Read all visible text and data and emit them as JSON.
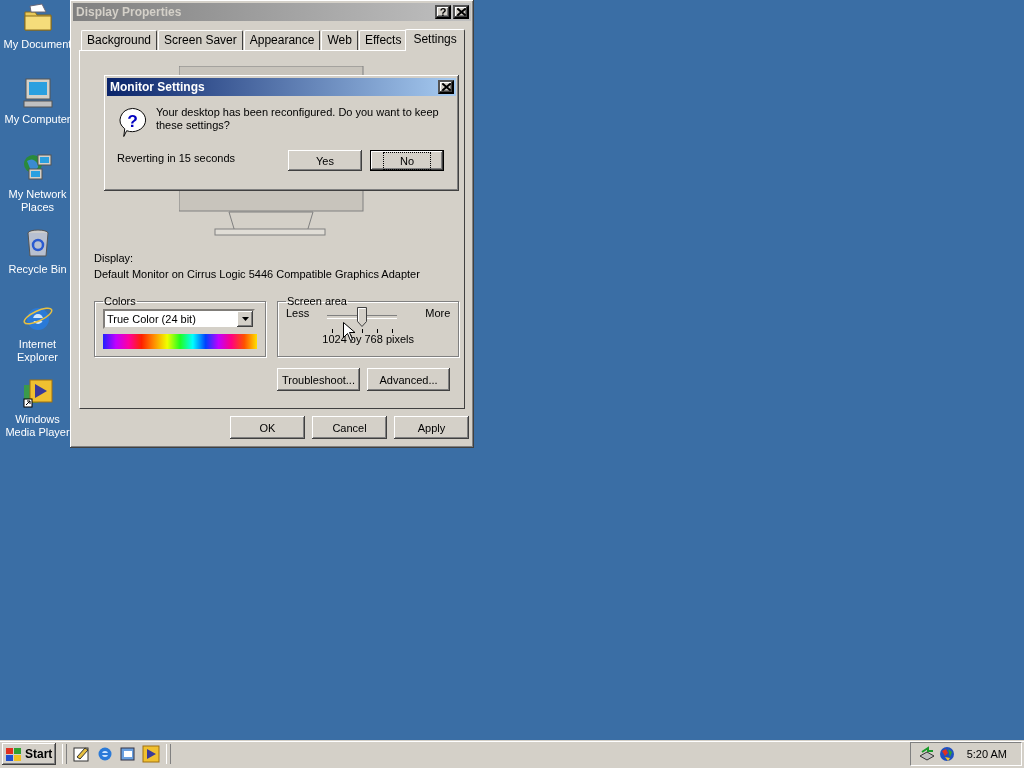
{
  "desktop_icons": [
    {
      "kind": "documents",
      "label": "My Document"
    },
    {
      "kind": "computer",
      "label": "My Computer"
    },
    {
      "kind": "network",
      "label": "My Network Places"
    },
    {
      "kind": "recycle",
      "label": "Recycle Bin"
    },
    {
      "kind": "browser",
      "label": "Internet Explorer"
    },
    {
      "kind": "media",
      "label": "Windows Media Player"
    }
  ],
  "display_properties": {
    "title": "Display Properties",
    "help_button": "?",
    "tabs": [
      {
        "label": "Background",
        "selected": false
      },
      {
        "label": "Screen Saver",
        "selected": false
      },
      {
        "label": "Appearance",
        "selected": false
      },
      {
        "label": "Web",
        "selected": false
      },
      {
        "label": "Effects",
        "selected": false
      },
      {
        "label": "Settings",
        "selected": true
      }
    ],
    "display_label": "Display:",
    "display_device": "Default Monitor on Cirrus Logic 5446 Compatible Graphics Adapter",
    "colors": {
      "label": "Colors",
      "value": "True Color (24 bit)"
    },
    "screen_area": {
      "label": "Screen area",
      "less": "Less",
      "more": "More",
      "level": 0.5,
      "reading": "1024 by 768 pixels"
    },
    "panel_buttons": [
      "Troubleshoot...",
      "Advanced..."
    ],
    "buttons": [
      {
        "label": "OK"
      },
      {
        "label": "Cancel"
      },
      {
        "label": "Apply"
      }
    ]
  },
  "monitor_settings": {
    "title": "Monitor Settings",
    "icon_glyph": "?",
    "message": "Your desktop has been reconfigured.  Do you want to keep these settings?",
    "countdown": "Reverting in 15 seconds",
    "buttons": [
      {
        "label": "Yes",
        "focused": false
      },
      {
        "label": "No",
        "focused": true
      }
    ]
  },
  "taskbar": {
    "start": "Start",
    "clock": "5:20 AM"
  }
}
